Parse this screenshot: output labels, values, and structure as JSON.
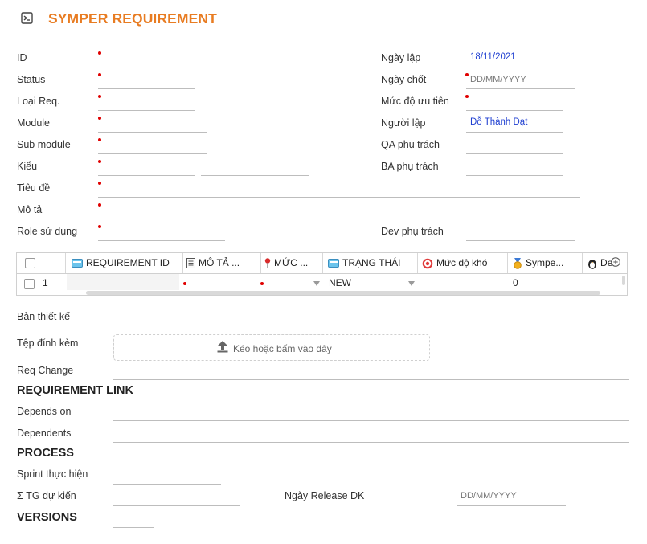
{
  "header": {
    "title": "SYMPER REQUIREMENT",
    "icon": "document-icon",
    "accent": "#e87c22"
  },
  "form": {
    "id_label": "ID",
    "status_label": "Status",
    "type_label": "Loại Req.",
    "module_label": "Module",
    "submodule_label": "Sub module",
    "kind_label": "Kiểu",
    "title_label": "Tiêu đề",
    "desc_label": "Mô tả",
    "role_label": "Role sử dụng",
    "created_date_label": "Ngày lập",
    "created_date_value": "18/11/2021",
    "closed_date_label": "Ngày chốt",
    "closed_date_placeholder": "DD/MM/YYYY",
    "priority_label": "Mức độ ưu tiên",
    "creator_label": "Người lập",
    "creator_value": "Đỗ Thành Đạt",
    "qa_label": "QA phụ trách",
    "ba_label": "BA phụ trách",
    "dev_label": "Dev phụ trách",
    "value_color": "#1f3fd1",
    "required_color": "#e00000"
  },
  "table": {
    "columns": [
      {
        "label": "REQUIREMENT ID",
        "icon": "card-icon"
      },
      {
        "label": "MÔ TẢ ...",
        "icon": "note-icon"
      },
      {
        "label": "MỨC ...",
        "icon": "pin-icon"
      },
      {
        "label": "TRẠNG THÁI",
        "icon": "card-icon"
      },
      {
        "label": "Mức độ khó",
        "icon": "target-icon"
      },
      {
        "label": "Sympe...",
        "icon": "medal-icon"
      },
      {
        "label": "Dev",
        "icon": "penguin-icon"
      }
    ],
    "row": {
      "index": "1",
      "status": "NEW",
      "symper_value": "0"
    }
  },
  "design_label": "Bản thiết kế",
  "attachment": {
    "label": "Tệp đính kèm",
    "dropzone_text": "Kéo hoặc bấm vào đây",
    "icon": "upload-icon"
  },
  "req_change_label": "Req Change",
  "links": {
    "heading": "REQUIREMENT LINK",
    "depends_on_label": "Depends on",
    "dependents_label": "Dependents"
  },
  "process": {
    "heading": "PROCESS",
    "sprint_label": "Sprint thực hiện",
    "estimate_label": "Σ TG dự kiến",
    "release_label": "Ngày Release DK",
    "release_placeholder": "DD/MM/YYYY"
  },
  "versions": {
    "heading": "VERSIONS"
  }
}
